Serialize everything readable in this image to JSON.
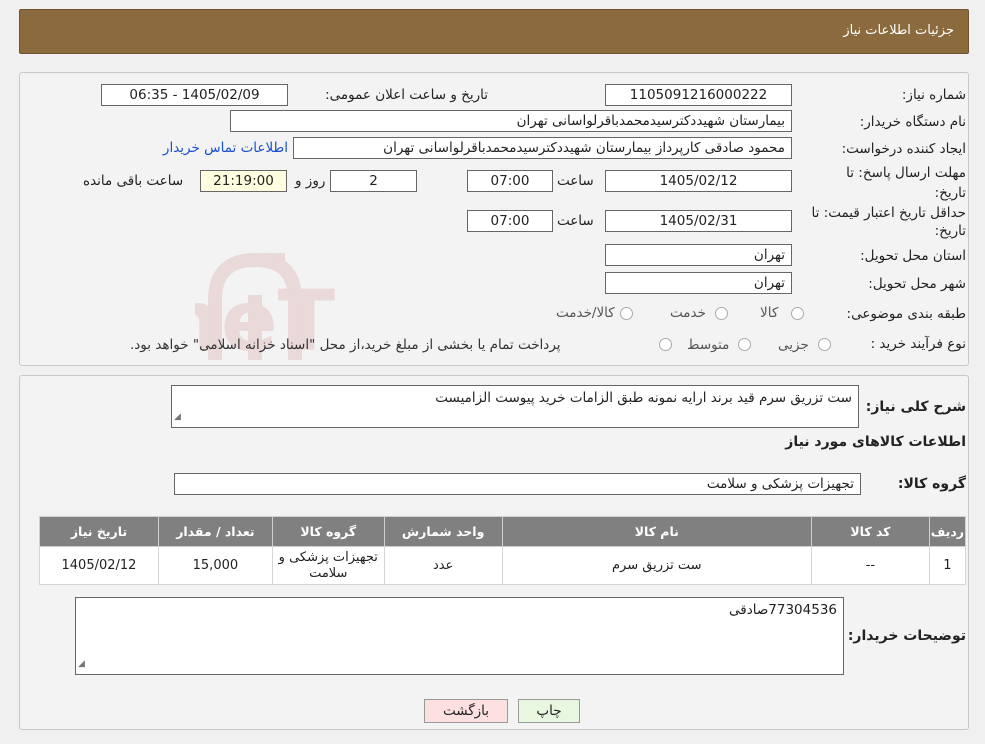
{
  "header": {
    "title": "جزئیات اطلاعات نیاز"
  },
  "details": {
    "need_number_label": "شماره نیاز:",
    "need_number": "1105091216000222",
    "announce_label": "تاریخ و ساعت اعلان عمومی:",
    "announce_value": "1405/02/09 - 06:35",
    "buyer_org_label": "نام دستگاه خریدار:",
    "buyer_org": "بیمارستان شهیددکترسیدمحمدباقرلواسانی تهران",
    "requester_label": "ایجاد کننده درخواست:",
    "requester": "محمود صادقی کارپرداز بیمارستان شهیددکترسیدمحمدباقرلواسانی تهران",
    "contact_link": "اطلاعات تماس خریدار",
    "deadline_label_1": "مهلت ارسال پاسخ: تا",
    "deadline_label_2": "تاریخ:",
    "deadline_date": "1405/02/12",
    "time_label": "ساعت",
    "deadline_time": "07:00",
    "days_value": "2",
    "days_label": "روز و",
    "remaining_time": "21:19:00",
    "remaining_label": "ساعت باقی مانده",
    "validity_label_1": "حداقل تاریخ اعتبار قیمت: تا",
    "validity_label_2": "تاریخ:",
    "validity_date": "1405/02/31",
    "validity_time": "07:00",
    "province_label": "استان محل تحویل:",
    "province": "تهران",
    "city_label": "شهر محل تحویل:",
    "city": "تهران",
    "category_label": "طبقه بندی موضوعی:",
    "category_options": [
      "کالا",
      "خدمت",
      "کالا/خدمت"
    ],
    "process_label": "نوع فرآیند خرید :",
    "process_options": [
      "جزیی",
      "متوسط"
    ],
    "process_note": "پرداخت تمام یا بخشی از مبلغ خرید،از محل \"اسناد خزانه اسلامی\" خواهد بود."
  },
  "description": {
    "label": "شرح کلی نیاز:",
    "text": "ست تزریق سرم قید برند ارایه نمونه طبق الزامات خرید پیوست الزامیست"
  },
  "goods": {
    "section_title": "اطلاعات کالاهای مورد نیاز",
    "group_label": "گروه کالا:",
    "group_value": "تجهیزات پزشکی و سلامت",
    "columns": [
      "ردیف",
      "کد کالا",
      "نام کالا",
      "واحد شمارش",
      "گروه کالا",
      "تعداد / مقدار",
      "تاریخ نیاز"
    ],
    "rows": [
      {
        "row": "1",
        "code": "--",
        "name": "ست تزریق سرم",
        "unit": "عدد",
        "group": "تجهیزات پزشکی و سلامت",
        "qty": "15,000",
        "date": "1405/02/12"
      }
    ]
  },
  "buyer_notes": {
    "label": "توضیحات خریدار:",
    "text": "77304536صادقی"
  },
  "buttons": {
    "print": "چاپ",
    "back": "بازگشت"
  },
  "watermark": {
    "text": "AriaTender.neT"
  },
  "colors": {
    "header_bg": "#8b6a3e",
    "link": "#1a4fd0",
    "table_header": "#808080",
    "back_button": "#fde0e0",
    "print_button": "#e8f8e0"
  }
}
